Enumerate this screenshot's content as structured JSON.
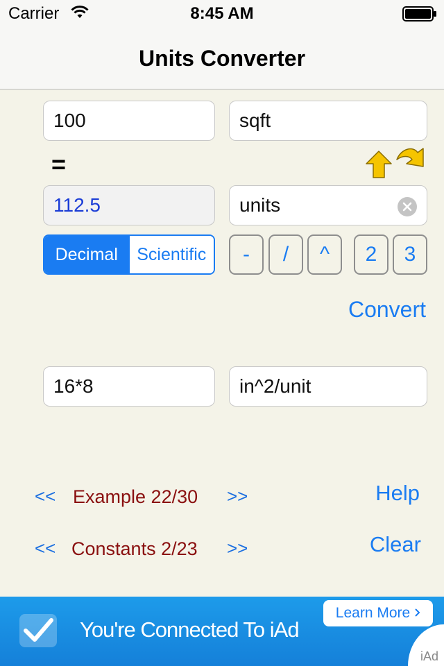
{
  "status": {
    "carrier": "Carrier",
    "time": "8:45 AM"
  },
  "nav": {
    "title": "Units Converter"
  },
  "converter": {
    "from_value": "100",
    "from_unit": "sqft",
    "equals": "=",
    "result_value": "112.5",
    "to_unit": "units",
    "format_options": [
      "Decimal",
      "Scientific"
    ],
    "format_selected": "Decimal",
    "keys": [
      "-",
      "/",
      "^",
      "2",
      "3"
    ],
    "convert_label": "Convert",
    "factor_value": "16*8",
    "factor_unit": "in^2/unit"
  },
  "examples": {
    "prev": "<<",
    "next": ">>",
    "label": "Example 22/30",
    "help": "Help"
  },
  "constants": {
    "prev": "<<",
    "next": ">>",
    "label": "Constants 2/23",
    "clear": "Clear"
  },
  "ad": {
    "text": "You're Connected To iAd",
    "button": "Learn More",
    "brand": "iAd"
  },
  "colors": {
    "accent": "#1a7cf2",
    "label_red": "#8a1010",
    "background": "#f4f3e8",
    "ad_blue": "#1a8ce4"
  }
}
